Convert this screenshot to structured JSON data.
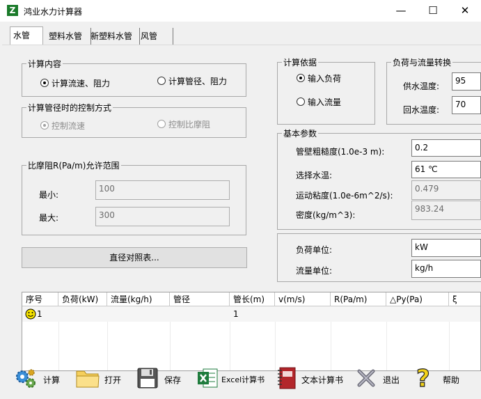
{
  "window": {
    "title": "鸿业水力计算器",
    "icon_letter": "Z",
    "minimize": "—",
    "maximize": "☐",
    "close": "✕"
  },
  "tabs": [
    {
      "label": "水管"
    },
    {
      "label": "塑料水管"
    },
    {
      "label": "新塑料水管"
    },
    {
      "label": "风管"
    }
  ],
  "calc_content": {
    "legend": "计算内容",
    "option1": "计算流速、阻力",
    "option2": "计算管径、阻力",
    "selected": "option1"
  },
  "control_method": {
    "legend": "计算管径时的控制方式",
    "option1": "控制流速",
    "option2": "控制比摩阻"
  },
  "friction_range": {
    "legend": "比摩阻R(Pa/m)允许范围",
    "min_label": "最小:",
    "min_value": "100",
    "max_label": "最大:",
    "max_value": "300"
  },
  "diameter_table_button": "直径对照表...",
  "calc_basis": {
    "legend": "计算依据",
    "option1": "输入负荷",
    "option2": "输入流量",
    "selected": "option1"
  },
  "load_conversion": {
    "legend": "负荷与流量转换",
    "supply_label": "供水温度:",
    "supply_value": "95",
    "return_label": "回水温度:",
    "return_value": "70"
  },
  "basic_params": {
    "legend": "基本参数",
    "roughness_label": "管壁粗糙度(1.0e-3 m):",
    "roughness_value": "0.2",
    "water_temp_label": "选择水温:",
    "water_temp_value": "61 ℃",
    "viscosity_label": "运动粘度(1.0e-6m^2/s):",
    "viscosity_value": "0.479",
    "density_label": "密度(kg/m^3):",
    "density_value": "983.24"
  },
  "units": {
    "load_label": "负荷单位:",
    "load_value": "kW",
    "flow_label": "流量单位:",
    "flow_value": "kg/h"
  },
  "grid": {
    "headers": [
      "序号",
      "负荷(kW)",
      "流量(kg/h)",
      "管径",
      "管长(m)",
      "v(m/s)",
      "R(Pa/m)",
      "△Py(Pa)",
      "ξ"
    ],
    "row1": {
      "index": "1",
      "length": "1"
    }
  },
  "toolbar": [
    {
      "label": "计算",
      "icon": "gears-icon"
    },
    {
      "label": "打开",
      "icon": "folder-icon"
    },
    {
      "label": "保存",
      "icon": "floppy-icon"
    },
    {
      "label": "Excel计算书",
      "icon": "excel-icon"
    },
    {
      "label": "文本计算书",
      "icon": "notebook-icon"
    },
    {
      "label": "退出",
      "icon": "exit-icon"
    },
    {
      "label": "帮助",
      "icon": "help-icon"
    }
  ],
  "colors": {
    "excel_green": "#1e7b3c",
    "folder_yellow": "#f5cf5c",
    "smiley_yellow": "#f7e400",
    "app_green": "#1a7a2a"
  }
}
